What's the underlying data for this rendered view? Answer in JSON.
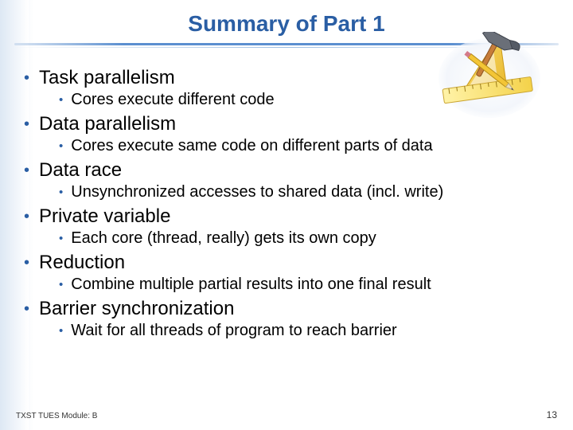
{
  "title": "Summary of Part 1",
  "bullets": [
    {
      "text": "Task parallelism",
      "sub": [
        "Cores execute different code"
      ]
    },
    {
      "text": "Data parallelism",
      "sub": [
        "Cores execute same code on different parts of data"
      ]
    },
    {
      "text": "Data race",
      "sub": [
        "Unsynchronized accesses to shared data (incl. write)"
      ]
    },
    {
      "text": "Private variable",
      "sub": [
        "Each core (thread, really) gets its own copy"
      ]
    },
    {
      "text": "Reduction",
      "sub": [
        "Combine multiple partial results into one final result"
      ]
    },
    {
      "text": "Barrier synchronization",
      "sub": [
        "Wait for all threads of program to reach barrier"
      ]
    }
  ],
  "footer": {
    "left": "TXST TUES Module: B",
    "right": "13"
  },
  "colors": {
    "accent": "#2a5ea4"
  }
}
